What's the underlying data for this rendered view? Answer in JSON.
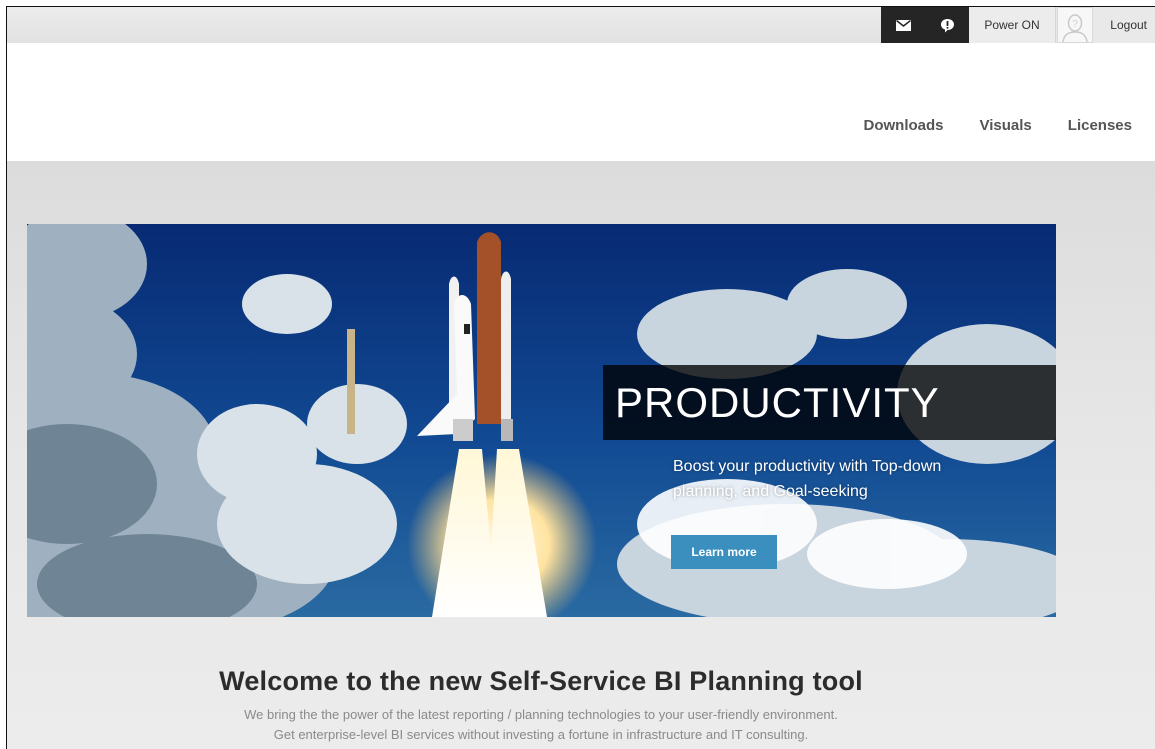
{
  "header": {
    "icons": [
      "mail-icon",
      "notification-icon"
    ],
    "power_on": "Power ON",
    "logout": "Logout"
  },
  "nav": {
    "items": [
      {
        "label": "Downloads"
      },
      {
        "label": "Visuals"
      },
      {
        "label": "Licenses"
      }
    ]
  },
  "hero": {
    "title": "PRODUCTIVITY",
    "line1": "Boost your productivity with Top-down",
    "line2": "planning, and Goal-seeking",
    "button": "Learn more"
  },
  "welcome": {
    "title": "Welcome to the new Self-Service BI Planning tool",
    "line1": "We bring the the power of the latest reporting / planning technologies to your user-friendly environment.",
    "line2": "Get enterprise-level BI services without investing a fortune in infrastructure and IT consulting."
  },
  "colors": {
    "accent": "#3a8fbf",
    "dark": "#252525"
  }
}
